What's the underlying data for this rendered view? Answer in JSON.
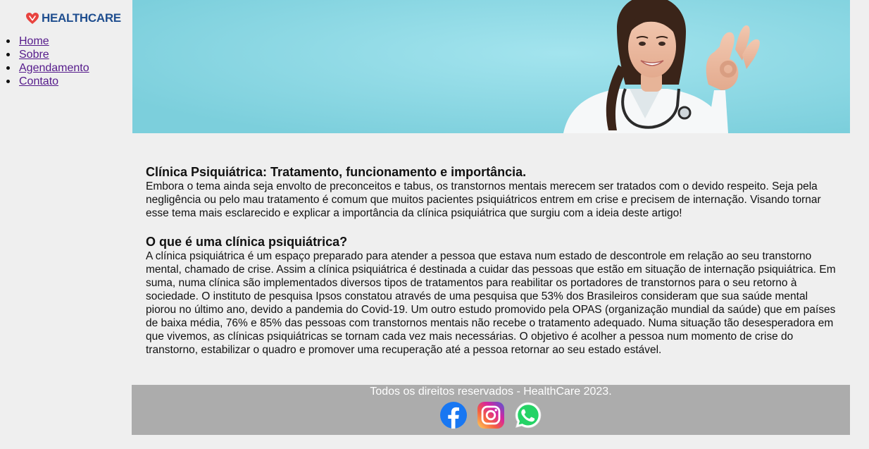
{
  "brand": {
    "name": "HEALTHCARE",
    "color": "#1f4e8f",
    "mark_color": "#e8433f"
  },
  "nav": {
    "items": [
      {
        "label": "Home"
      },
      {
        "label": "Sobre"
      },
      {
        "label": "Agendamento"
      },
      {
        "label": "Contato"
      }
    ]
  },
  "hero": {
    "image": "doctor-ok-gesture-photo",
    "background_color": "#8fdce8"
  },
  "article": {
    "title": "Clínica Psiquiátrica: Tratamento, funcionamento e importância.",
    "intro": "Embora o tema ainda seja envolto de preconceitos e tabus, os transtornos mentais merecem ser tratados com o devido respeito. Seja pela negligência ou pelo mau tratamento é comum que muitos pacientes psiquiátricos entrem em crise e precisem de internação. Visando tornar esse tema mais esclarecido e explicar a importância da clínica psiquiátrica que surgiu com a ideia deste artigo!",
    "section_title": "O que é uma clínica psiquiátrica?",
    "section_body": "A clínica psiquiátrica é um espaço preparado para atender a pessoa que estava num estado de descontrole em relação ao seu transtorno mental, chamado de crise. Assim a clínica psiquiátrica é destinada a cuidar das pessoas que estão em situação de internação psiquiátrica. Em suma, numa clínica são implementados diversos tipos de tratamentos para reabilitar os portadores de transtornos para o seu retorno à sociedade. O instituto de pesquisa Ipsos constatou através de uma pesquisa que 53% dos Brasileiros consideram que sua saúde mental piorou no último ano, devido a pandemia do Covid-19. Um outro estudo promovido pela OPAS (organização mundial da saúde) que em países de baixa média, 76% e 85% das pessoas com transtornos mentais não recebe o tratamento adequado. Numa situação tão desesperadora em que vivemos, as clínicas psiquiátricas se tornam cada vez mais necessárias. O objetivo é acolher a pessoa num momento de crise do transtorno, estabilizar o quadro e promover uma recuperação até a pessoa retornar ao seu estado estável."
  },
  "footer": {
    "text": "Todos os direitos reservados - HealthCare 2023.",
    "background_color": "#acacac",
    "socials": [
      {
        "icon": "facebook-icon",
        "color": "#1877f2"
      },
      {
        "icon": "instagram-icon",
        "color": "#d6249f"
      },
      {
        "icon": "whatsapp-icon",
        "color": "#25d366"
      }
    ]
  }
}
